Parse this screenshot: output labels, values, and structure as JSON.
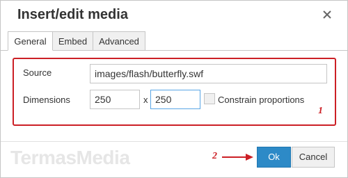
{
  "dialog": {
    "title": "Insert/edit media",
    "tabs": [
      {
        "label": "General",
        "active": true
      },
      {
        "label": "Embed",
        "active": false
      },
      {
        "label": "Advanced",
        "active": false
      }
    ],
    "source": {
      "label": "Source",
      "value": "images/flash/butterfly.swf"
    },
    "dimensions": {
      "label": "Dimensions",
      "width": "250",
      "separator": "x",
      "height": "250"
    },
    "constrain": {
      "label": "Constrain proportions",
      "checked": false
    },
    "buttons": {
      "ok": "Ok",
      "cancel": "Cancel"
    }
  },
  "annotations": {
    "marker_1": "1",
    "marker_2": "2",
    "accent_color": "#cc1f25"
  },
  "watermark": "TermasMedia",
  "colors": {
    "primary_button": "#2d8ac7",
    "focus_border": "#59a5e5"
  }
}
